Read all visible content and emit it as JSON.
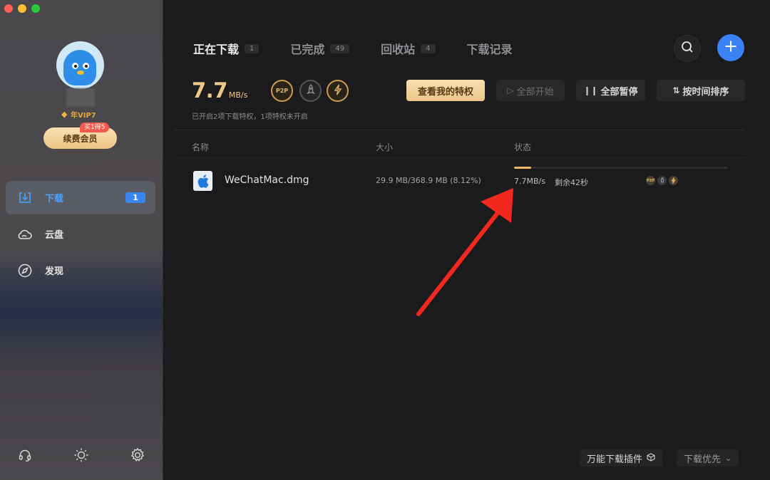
{
  "window": {
    "traffic_lights": [
      "close",
      "minimize",
      "zoom"
    ],
    "colors": {
      "close": "#fe5f57",
      "minimize": "#febc2e",
      "zoom": "#28c840"
    }
  },
  "sidebar": {
    "vip_label": "年VIP7",
    "renew_button": "续费会员",
    "promo_tag": "买1得5",
    "nav": [
      {
        "label": "下载",
        "count": "1",
        "icon": "download-icon",
        "active": true
      },
      {
        "label": "云盘",
        "icon": "cloud-icon"
      },
      {
        "label": "发现",
        "icon": "compass-icon"
      }
    ],
    "bottom_icons": [
      "headset-icon",
      "theme-sun-icon",
      "settings-gear-icon"
    ]
  },
  "tabs": [
    {
      "label": "正在下载",
      "count": "1",
      "active": true
    },
    {
      "label": "已完成",
      "count": "49"
    },
    {
      "label": "回收站",
      "count": "4"
    },
    {
      "label": "下载记录"
    }
  ],
  "header": {
    "speed_value": "7.7",
    "speed_unit": "MB/s",
    "privilege_note": "已开启2项下载特权，1项特权未开启",
    "privileges": [
      {
        "name": "P2P",
        "icon": "p2p-icon",
        "enabled": true
      },
      {
        "name": "rocket",
        "icon": "rocket-icon",
        "enabled": false
      },
      {
        "name": "bolt",
        "icon": "bolt-icon",
        "enabled": true
      }
    ],
    "buttons": {
      "view_privilege": "查看我的特权",
      "start_all": "全部开始",
      "pause_all": "全部暂停",
      "sort_by_time": "按时间排序"
    },
    "accent_color": "#3b82f6",
    "gold_color": "#f0c98a"
  },
  "table": {
    "columns": [
      "名称",
      "大小",
      "状态"
    ],
    "rows": [
      {
        "name": "WeChatMac.dmg",
        "icon": "apple-icon",
        "size": "29.9 MB/368.9 MB (8.12%)",
        "progress_percent": 8.12,
        "speed": "7.7MB/s",
        "remaining": "剩余42秒"
      }
    ]
  },
  "footer": {
    "plugin_button": "万能下载插件",
    "priority_select": "下载优先"
  },
  "annotation": {
    "type": "arrow",
    "color": "#f2281f"
  }
}
